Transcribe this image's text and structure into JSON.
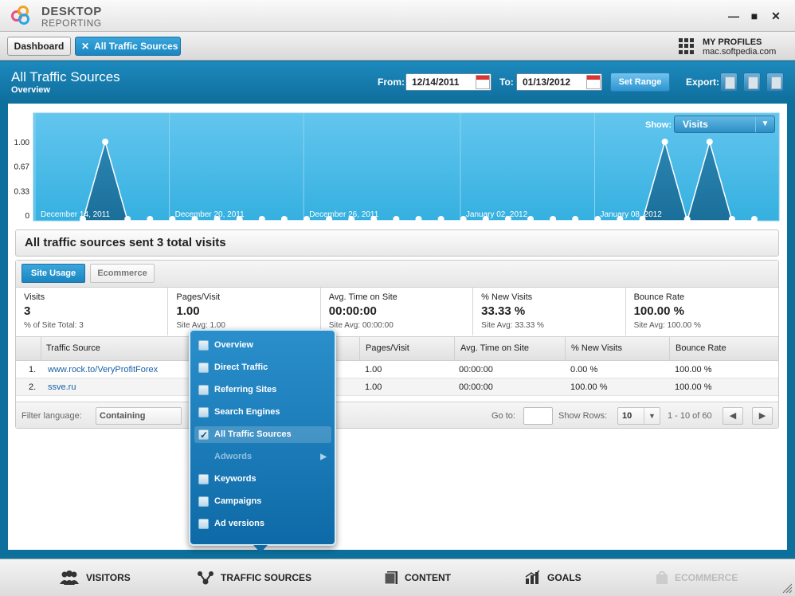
{
  "app": {
    "title_line1": "DESKTOP",
    "title_line2": "REPORTING"
  },
  "window": {
    "minimize": "—",
    "maximize": "■",
    "close": "✕"
  },
  "tabs": {
    "dashboard": "Dashboard",
    "active": "All Traffic Sources",
    "active_close": "✕"
  },
  "profiles": {
    "title": "MY PROFILES",
    "site": "mac.softpedia.com"
  },
  "header": {
    "title": "All Traffic Sources",
    "subtitle": "Overview",
    "from_label": "From:",
    "from_value": "12/14/2011",
    "to_label": "To:",
    "to_value": "01/13/2012",
    "set_range": "Set Range",
    "export_label": "Export:"
  },
  "chart_data": {
    "type": "area",
    "y_ticks": [
      "1.00",
      "0.67",
      "0.33",
      "0"
    ],
    "ylim": [
      0,
      1
    ],
    "x_labels": [
      "December 14, 2011",
      "December 20, 2011",
      "December 26, 2011",
      "January 02, 2012",
      "January 08, 2012"
    ],
    "x": [
      "2011-12-14",
      "2011-12-15",
      "2011-12-16",
      "2011-12-17",
      "2011-12-18",
      "2011-12-19",
      "2011-12-20",
      "2011-12-21",
      "2011-12-22",
      "2011-12-23",
      "2011-12-24",
      "2011-12-25",
      "2011-12-26",
      "2011-12-27",
      "2011-12-28",
      "2011-12-29",
      "2011-12-30",
      "2011-12-31",
      "2012-01-01",
      "2012-01-02",
      "2012-01-03",
      "2012-01-04",
      "2012-01-05",
      "2012-01-06",
      "2012-01-07",
      "2012-01-08",
      "2012-01-09",
      "2012-01-10",
      "2012-01-11",
      "2012-01-12",
      "2012-01-13"
    ],
    "series": [
      {
        "values": [
          0,
          1,
          0,
          0,
          0,
          0,
          0,
          0,
          0,
          0,
          0,
          0,
          0,
          0,
          0,
          0,
          0,
          0,
          0,
          0,
          0,
          0,
          0,
          0,
          0,
          0,
          1,
          0,
          1,
          0,
          0
        ]
      }
    ],
    "fill_color": "#1a6f99",
    "background_color": "#35b0e0"
  },
  "show": {
    "label": "Show:",
    "value": "Visits",
    "arrow": "▼"
  },
  "summary": "All traffic sources sent 3 total visits",
  "usage_tabs": {
    "site_usage": "Site Usage",
    "ecommerce": "Ecommerce"
  },
  "metrics": [
    {
      "title": "Visits",
      "value": "3",
      "sub": "% of Site Total: 3"
    },
    {
      "title": "Pages/Visit",
      "value": "1.00",
      "sub": "Site Avg: 1.00"
    },
    {
      "title": "Avg. Time on Site",
      "value": "00:00:00",
      "sub": "Site Avg: 00:00:00"
    },
    {
      "title": "% New Visits",
      "value": "33.33 %",
      "sub": "Site Avg: 33.33 %"
    },
    {
      "title": "Bounce Rate",
      "value": "100.00 %",
      "sub": "Site Avg: 100.00 %"
    }
  ],
  "table": {
    "headers": [
      "Traffic Source",
      "Pages/Visit",
      "Avg. Time on Site",
      "% New Visits",
      "Bounce Rate"
    ],
    "rows": [
      {
        "num": "1.",
        "source": "www.rock.to/VeryProfitForex",
        "pages": "1.00",
        "time": "00:00:00",
        "new": "0.00 %",
        "bounce": "100.00 %"
      },
      {
        "num": "2.",
        "source": "ssve.ru",
        "pages": "1.00",
        "time": "00:00:00",
        "new": "100.00 %",
        "bounce": "100.00 %"
      }
    ]
  },
  "filter": {
    "label": "Filter language:",
    "mode": "Containing",
    "goto_label": "Go to:",
    "rows_label": "Show Rows:",
    "rows_value": "10",
    "range": "1 - 10 of 60",
    "prev": "◀",
    "next": "▶"
  },
  "menu": [
    {
      "label": "Overview",
      "checked": false
    },
    {
      "label": "Direct Traffic",
      "checked": false
    },
    {
      "label": "Referring Sites",
      "checked": false
    },
    {
      "label": "Search Engines",
      "checked": false
    },
    {
      "label": "All Traffic Sources",
      "checked": true
    },
    {
      "label": "Adwords",
      "disabled": true,
      "submenu_arrow": "▶"
    },
    {
      "label": "Keywords",
      "checked": false
    },
    {
      "label": "Campaigns",
      "checked": false
    },
    {
      "label": "Ad versions",
      "checked": false
    }
  ],
  "bottom_nav": [
    "VISITORS",
    "TRAFFIC SOURCES",
    "CONTENT",
    "GOALS",
    "ECOMMERCE"
  ]
}
